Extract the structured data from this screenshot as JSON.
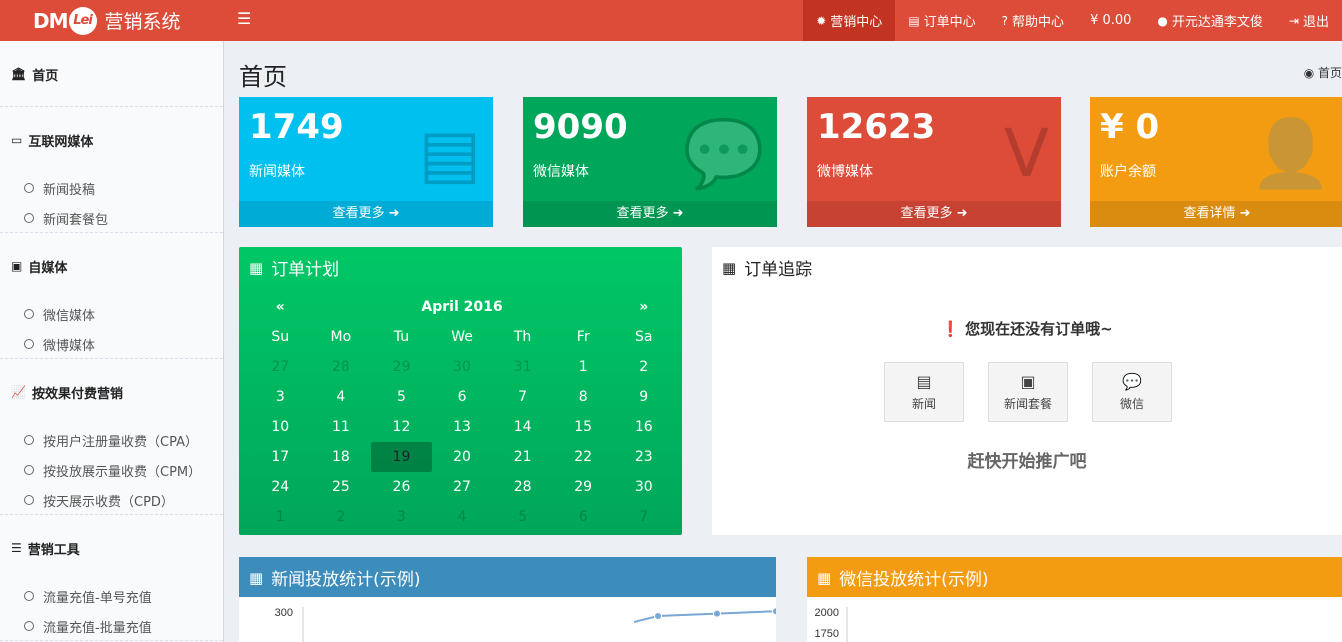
{
  "header": {
    "logo_mark": "DM",
    "logo_circle": "Lei",
    "logo_text": "营销系统",
    "menu_icon": "bars-icon",
    "nav": [
      {
        "icon": "bug-icon",
        "label": "营销中心",
        "active": true
      },
      {
        "icon": "file-icon",
        "label": "订单中心",
        "active": false
      },
      {
        "icon": "question-circle-icon",
        "label": "帮助中心",
        "active": false
      },
      {
        "icon": "none",
        "label": "¥ 0.00",
        "active": false
      },
      {
        "icon": "user-icon",
        "label": "开元达通李文俊",
        "active": false
      },
      {
        "icon": "sign-out-icon",
        "label": "退出",
        "active": false
      }
    ]
  },
  "sidebar": {
    "sections": [
      {
        "title": "首页",
        "icon": "bank-icon",
        "items": []
      },
      {
        "title": "互联网媒体",
        "icon": "desktop-icon",
        "items": [
          "新闻投稿",
          "新闻套餐包"
        ]
      },
      {
        "title": "自媒体",
        "icon": "newspaper-icon",
        "items": [
          "微信媒体",
          "微博媒体"
        ]
      },
      {
        "title": "按效果付费营销",
        "icon": "line-chart-icon",
        "items": [
          "按用户注册量收费（CPA）",
          "按投放展示量收费（CPM）",
          "按天展示收费（CPD）"
        ]
      },
      {
        "title": "营销工具",
        "icon": "server-icon",
        "items": [
          "流量充值-单号充值",
          "流量充值-批量充值"
        ]
      }
    ]
  },
  "main": {
    "title": "首页",
    "breadcrumb": "首页",
    "breadcrumb_icon": "dashboard-icon",
    "boxes": [
      {
        "value": "1749",
        "label": "新闻媒体",
        "link": "查看更多",
        "color": "#00c0ef",
        "icon": "newspaper-icon"
      },
      {
        "value": "9090",
        "label": "微信媒体",
        "link": "查看更多",
        "color": "#00a65a",
        "icon": "wechat-icon"
      },
      {
        "value": "12623",
        "label": "微博媒体",
        "link": "查看更多",
        "color": "#dd4b39",
        "icon": "vimeo-icon"
      },
      {
        "value": "¥ 0",
        "label": "账户余额",
        "link": "查看详情",
        "color": "#f39c12",
        "icon": "user-icon"
      }
    ],
    "calendar": {
      "title": "订单计划",
      "prev": "«",
      "next": "»",
      "month": "April 2016",
      "weekdays": [
        "Su",
        "Mo",
        "Tu",
        "We",
        "Th",
        "Fr",
        "Sa"
      ],
      "weeks": [
        [
          "27",
          "28",
          "29",
          "30",
          "31",
          "1",
          "2"
        ],
        [
          "3",
          "4",
          "5",
          "6",
          "7",
          "8",
          "9"
        ],
        [
          "10",
          "11",
          "12",
          "13",
          "14",
          "15",
          "16"
        ],
        [
          "17",
          "18",
          "19",
          "20",
          "21",
          "22",
          "23"
        ],
        [
          "24",
          "25",
          "26",
          "27",
          "28",
          "29",
          "30"
        ],
        [
          "1",
          "2",
          "3",
          "4",
          "5",
          "6",
          "7"
        ]
      ],
      "selected": "19"
    },
    "tracking": {
      "title": "订单追踪",
      "empty": "您现在还没有订单哦~",
      "buttons": [
        {
          "label": "新闻",
          "icon": "file-text-icon"
        },
        {
          "label": "新闻套餐",
          "icon": "newspaper-icon"
        },
        {
          "label": "微信",
          "icon": "wechat-icon"
        }
      ],
      "promo": "赶快开始推广吧"
    },
    "stats": [
      {
        "title": "新闻投放统计(示例)",
        "color": "#3c8dbc"
      },
      {
        "title": "微信投放统计(示例)",
        "color": "#f39c12"
      }
    ]
  },
  "chart_data": [
    {
      "type": "line",
      "title": "新闻投放统计(示例)",
      "y_ticks_visible": [
        "300"
      ],
      "series": [
        {
          "values": [
            280,
            284,
            288
          ]
        }
      ]
    },
    {
      "type": "line",
      "title": "微信投放统计(示例)",
      "y_ticks_visible": [
        "2000",
        "1750"
      ],
      "series": []
    }
  ]
}
